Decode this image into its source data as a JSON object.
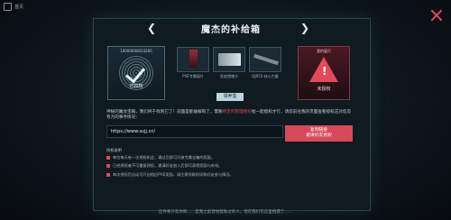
{
  "topbar": {
    "title": "首页"
  },
  "header": {
    "title": "魔杰的补给箱"
  },
  "left_card": {
    "number": "10000000024285",
    "status": "已授权"
  },
  "rewards": [
    {
      "label": "PVE专属丽片"
    },
    {
      "label": "狂徒猎魂卡"
    },
    {
      "label": "QJ055-核心力量"
    }
  ],
  "extra_button": "领养盒",
  "right_card": {
    "header": "我的复打",
    "status": "未授权"
  },
  "description": {
    "part1": "神秘的魔龙宝箱，我们终于找到它了！前面是能破解和了，需要",
    "highlight": "绑定的管理授权",
    "part2": "给一起授权才行，请您前往我的页面查看授权这对您及有力的事件情况："
  },
  "url": "https://www.sujj.cn/",
  "copy_button": {
    "line1": "复制链接",
    "line2": "邀请好友授权"
  },
  "notes": {
    "title": "授权说明",
    "items": [
      "每位每天有一次授权机会，通过后即可开放专属宝箱的奖励。",
      "已经授权者不可重复授权，邀请好友加入后即可获得奖励与补给。",
      "每次授权后自动可开启相应PVE奖励，请注意领取时间和好友参与情况。"
    ]
  },
  "footer": "这件事只有你和……是我之前曾经帮助过的人，现在我们在这里相遇了……"
}
